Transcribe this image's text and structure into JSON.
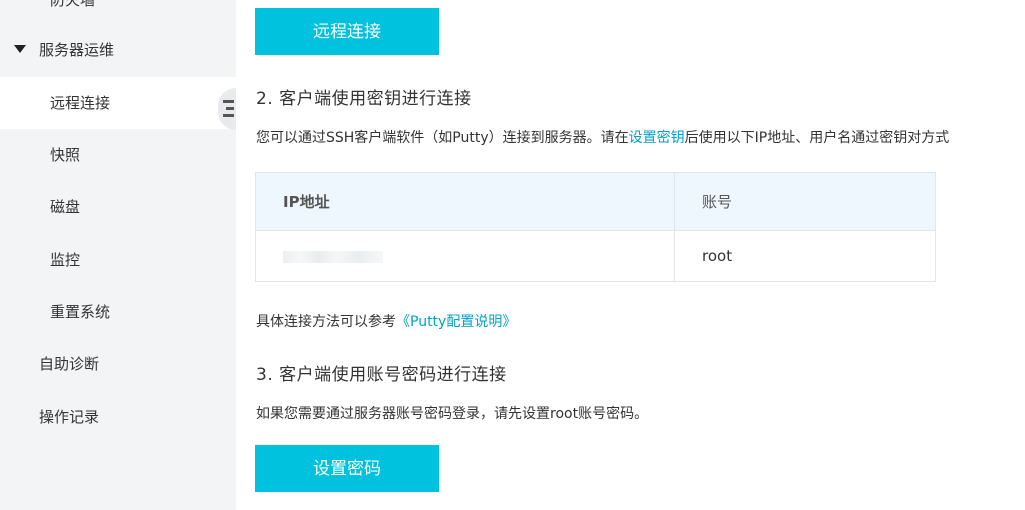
{
  "sidebar": {
    "items": [
      {
        "label": "防火墙"
      },
      {
        "label": "服务器运维"
      },
      {
        "label": "远程连接"
      },
      {
        "label": "快照"
      },
      {
        "label": "磁盘"
      },
      {
        "label": "监控"
      },
      {
        "label": "重置系统"
      },
      {
        "label": "自助诊断"
      },
      {
        "label": "操作记录"
      }
    ]
  },
  "main": {
    "remote_connect_button": "远程连接",
    "section2": {
      "heading": "2. 客户端使用密钥进行连接",
      "desc_before": "您可以通过SSH客户端软件（如Putty）连接到服务器。请在",
      "desc_link": "设置密钥",
      "desc_after": "后使用以下IP地址、用户名通过密钥对方式",
      "table": {
        "headers": [
          "IP地址",
          "账号"
        ],
        "rows": [
          {
            "ip": "",
            "account": "root"
          }
        ]
      },
      "ref_before": "具体连接方法可以参考",
      "ref_link": "《Putty配置说明》"
    },
    "section3": {
      "heading": "3. 客户端使用账号密码进行连接",
      "desc": "如果您需要通过服务器账号密码登录，请先设置root账号密码。",
      "set_password_button": "设置密码"
    }
  }
}
